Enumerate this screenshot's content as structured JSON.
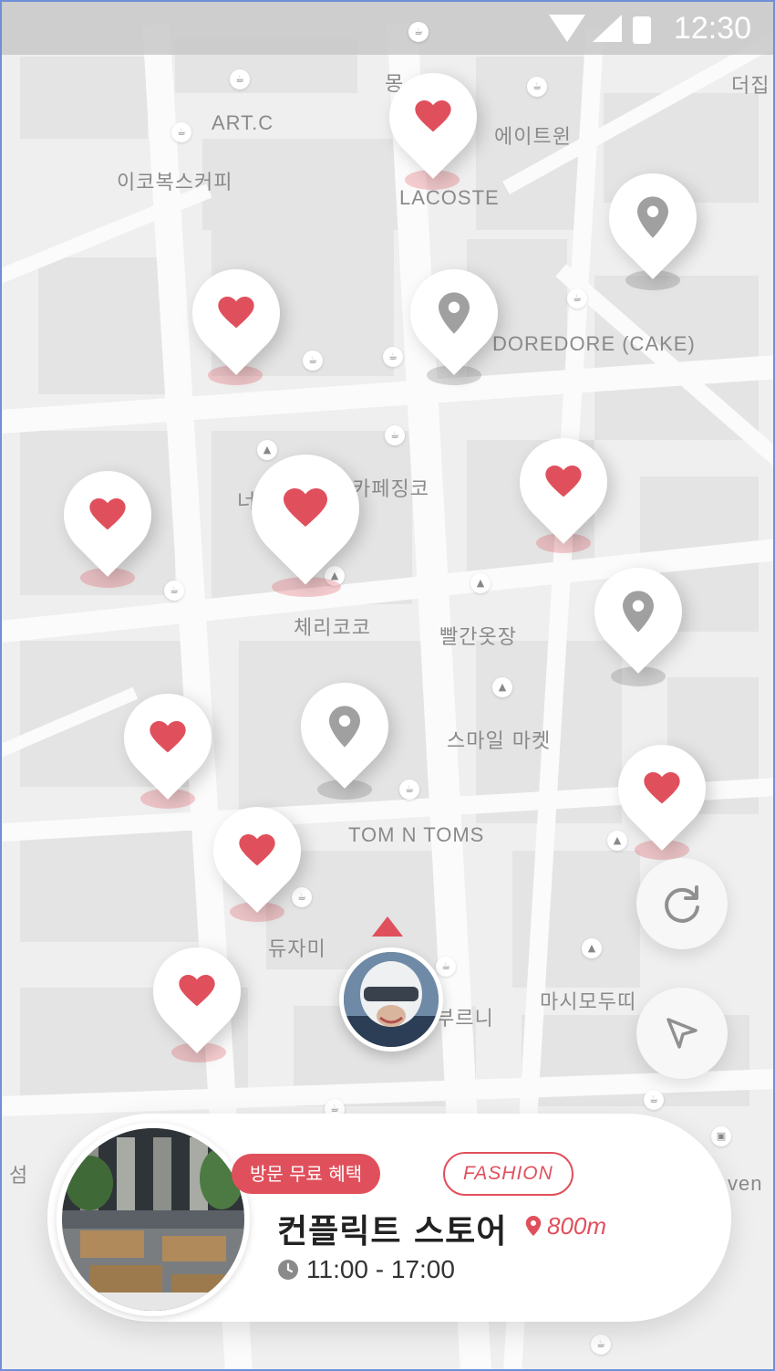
{
  "status_bar": {
    "time": "12:30"
  },
  "map": {
    "labels": [
      "몽",
      "ART.C",
      "에이트윈",
      "더집",
      "이코복스커피",
      "LACOSTE",
      "DOREDORE (CAKE)",
      "카페징코",
      "너",
      "체리코코",
      "빨간옷장",
      "스마일 마켓",
      "TOM N TOMS",
      "듀자미",
      "부르니",
      "마시모두띠",
      "섬",
      "ven"
    ],
    "pins": [
      {
        "kind": "favorite",
        "icon": "heart-icon"
      },
      {
        "kind": "place",
        "icon": "location-pin-icon"
      },
      {
        "kind": "favorite",
        "icon": "heart-icon"
      },
      {
        "kind": "place",
        "icon": "location-pin-icon"
      },
      {
        "kind": "favorite",
        "icon": "heart-icon"
      },
      {
        "kind": "favorite",
        "icon": "heart-icon"
      },
      {
        "kind": "favorite",
        "icon": "heart-icon"
      },
      {
        "kind": "place",
        "icon": "location-pin-icon"
      },
      {
        "kind": "favorite",
        "icon": "heart-icon"
      },
      {
        "kind": "place",
        "icon": "location-pin-icon"
      },
      {
        "kind": "favorite",
        "icon": "heart-icon"
      },
      {
        "kind": "favorite",
        "icon": "heart-icon"
      },
      {
        "kind": "favorite",
        "icon": "heart-icon"
      }
    ],
    "colors": {
      "accent": "#e0505c",
      "pin_gray": "#a0a0a0",
      "road": "#ffffff",
      "block": "#e6e6e6"
    }
  },
  "controls": {
    "refresh_icon": "refresh-icon",
    "locate_icon": "navigation-arrow-icon"
  },
  "store_card": {
    "badge_benefit": "방문 무료 혜택",
    "badge_category": "FASHION",
    "name": "컨플릭트 스토어",
    "distance": "800m",
    "hours": "11:00 - 17:00"
  }
}
